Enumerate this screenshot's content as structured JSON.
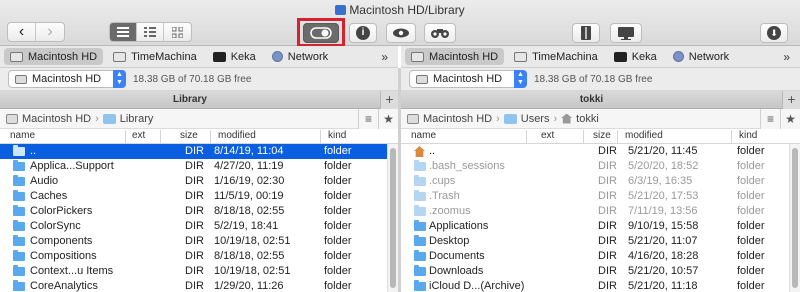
{
  "window": {
    "title": "Macintosh HD/Library"
  },
  "toolbar": {
    "back": "‹",
    "forward": "›",
    "view_modes": [
      "list-view-icon",
      "detail-view-icon",
      "icon-view-icon"
    ],
    "center_buttons": [
      "toggle-icon",
      "info-icon",
      "eye-icon",
      "binoculars-icon"
    ],
    "right_buttons": [
      "archive-icon",
      "terminal-icon",
      "download-icon"
    ],
    "info_glyph": "i",
    "download_glyph": "⬇"
  },
  "volumes": [
    {
      "label": "Macintosh HD",
      "icon": "disk-icon",
      "active": true
    },
    {
      "label": "TimeMachina",
      "icon": "disk-icon",
      "active": false
    },
    {
      "label": "Keka",
      "icon": "keka-icon",
      "active": false
    },
    {
      "label": "Network",
      "icon": "network-icon",
      "active": false
    }
  ],
  "more": "»",
  "left": {
    "drive": "Macintosh HD",
    "free": "18.38 GB of 70.18 GB free",
    "header": "Library",
    "crumbs": [
      "Macintosh HD",
      "Library"
    ],
    "columns": [
      "name",
      "ext",
      "size",
      "modified",
      "kind"
    ],
    "rows": [
      {
        "name": "..",
        "ext": "",
        "size": "DIR",
        "modified": "8/14/19, 11:04",
        "kind": "folder",
        "selected": true
      },
      {
        "name": "Applica...Support",
        "ext": "",
        "size": "DIR",
        "modified": "4/27/20, 11:19",
        "kind": "folder"
      },
      {
        "name": "Audio",
        "ext": "",
        "size": "DIR",
        "modified": "1/16/19, 02:30",
        "kind": "folder"
      },
      {
        "name": "Caches",
        "ext": "",
        "size": "DIR",
        "modified": "11/5/19, 00:19",
        "kind": "folder"
      },
      {
        "name": "ColorPickers",
        "ext": "",
        "size": "DIR",
        "modified": "8/18/18, 02:55",
        "kind": "folder"
      },
      {
        "name": "ColorSync",
        "ext": "",
        "size": "DIR",
        "modified": "5/2/19, 18:41",
        "kind": "folder"
      },
      {
        "name": "Components",
        "ext": "",
        "size": "DIR",
        "modified": "10/19/18, 02:51",
        "kind": "folder"
      },
      {
        "name": "Compositions",
        "ext": "",
        "size": "DIR",
        "modified": "8/18/18, 02:55",
        "kind": "folder"
      },
      {
        "name": "Context...u Items",
        "ext": "",
        "size": "DIR",
        "modified": "10/19/18, 02:51",
        "kind": "folder"
      },
      {
        "name": "CoreAnalytics",
        "ext": "",
        "size": "DIR",
        "modified": "1/29/20, 11:26",
        "kind": "folder"
      }
    ]
  },
  "right": {
    "drive": "Macintosh HD",
    "free": "18.38 GB of 70.18 GB free",
    "header": "tokki",
    "crumbs": [
      "Macintosh HD",
      "Users",
      "tokki"
    ],
    "columns": [
      "name",
      "ext",
      "size",
      "modified",
      "kind"
    ],
    "rows": [
      {
        "name": "..",
        "ext": "",
        "size": "DIR",
        "modified": "5/21/20, 11:45",
        "kind": "folder",
        "home": true
      },
      {
        "name": ".bash_sessions",
        "ext": "",
        "size": "DIR",
        "modified": "5/20/20, 18:52",
        "kind": "folder",
        "dim": true
      },
      {
        "name": ".cups",
        "ext": "",
        "size": "DIR",
        "modified": "6/3/19, 16:35",
        "kind": "folder",
        "dim": true
      },
      {
        "name": ".Trash",
        "ext": "",
        "size": "DIR",
        "modified": "5/21/20, 17:53",
        "kind": "folder",
        "dim": true
      },
      {
        "name": ".zoomus",
        "ext": "",
        "size": "DIR",
        "modified": "7/11/19, 13:56",
        "kind": "folder",
        "dim": true
      },
      {
        "name": "Applications",
        "ext": "",
        "size": "DIR",
        "modified": "9/10/19, 15:58",
        "kind": "folder"
      },
      {
        "name": "Desktop",
        "ext": "",
        "size": "DIR",
        "modified": "5/21/20, 11:07",
        "kind": "folder"
      },
      {
        "name": "Documents",
        "ext": "",
        "size": "DIR",
        "modified": "4/16/20, 18:28",
        "kind": "folder"
      },
      {
        "name": "Downloads",
        "ext": "",
        "size": "DIR",
        "modified": "5/21/20, 10:57",
        "kind": "folder"
      },
      {
        "name": "iCloud D...(Archive)",
        "ext": "",
        "size": "DIR",
        "modified": "5/21/20, 11:18",
        "kind": "folder"
      }
    ]
  },
  "colors": {
    "selection": "#0a5fe0",
    "folder": "#5aa9ec",
    "accent": "#3b82f6",
    "highlight": "#d4232f"
  }
}
